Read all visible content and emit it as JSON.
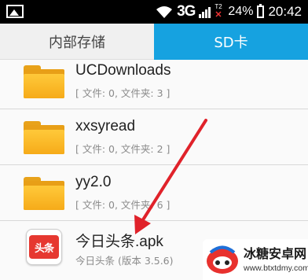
{
  "status_bar": {
    "network": "3G",
    "sim_label": "T2",
    "battery": "24%",
    "time": "20:42"
  },
  "tabs": [
    {
      "label": "内部存储",
      "selected": false
    },
    {
      "label": "SD卡",
      "selected": true
    }
  ],
  "files": [
    {
      "name": "UCDownloads",
      "meta": "[ 文件: 0, 文件夹: 3 ]",
      "icon": "folder-icon"
    },
    {
      "name": "xxsyread",
      "meta": "[ 文件: 0, 文件夹: 2 ]",
      "icon": "folder-icon"
    },
    {
      "name": "yy2.0",
      "meta": "[ 文件: 0, 文件夹: 6 ]",
      "icon": "folder-icon"
    },
    {
      "name": "今日头条.apk",
      "meta": "今日头条 (版本 3.5.6)",
      "icon": "toutiao-app-icon",
      "icon_text": "头条"
    }
  ],
  "watermark": {
    "title": "冰糖安卓网",
    "url": "www.btxtdmy.com"
  },
  "colors": {
    "tab_selected": "#16a2e0",
    "folder": "#f6ab19",
    "arrow": "#e0222a"
  }
}
